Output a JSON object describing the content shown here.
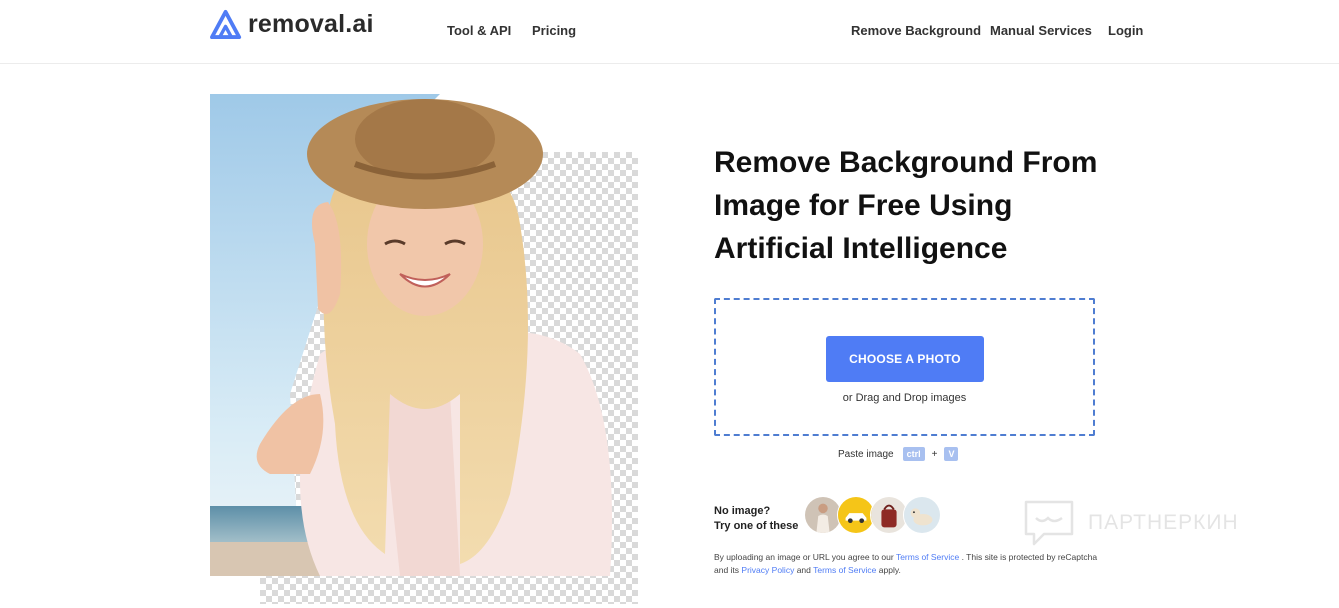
{
  "header": {
    "logo_text": "removal.ai",
    "nav_left": [
      "Tool & API",
      "Pricing"
    ],
    "nav_right": [
      "Remove Background",
      "Manual Services",
      "Login"
    ]
  },
  "hero": {
    "headline": "Remove Background From Image for Free Using Artificial Intelligence"
  },
  "upload": {
    "button_label": "CHOOSE A PHOTO",
    "drag_text": "or Drag and Drop images",
    "paste_label": "Paste image",
    "key_ctrl": "ctrl",
    "key_plus": "+",
    "key_v": "V"
  },
  "samples": {
    "prompt_line1": "No image?",
    "prompt_line2": "Try one of these",
    "items": [
      "person-sample",
      "car-sample",
      "bag-sample",
      "dog-sample"
    ]
  },
  "legal": {
    "part1": "By uploading an image or URL you agree to our",
    "tos_link": "Terms of Service",
    "part2": ". This site is protected by reCaptcha and its",
    "privacy_link": "Privacy Policy",
    "part3": "and",
    "tos_link2": "Terms of Service",
    "part4": "apply."
  },
  "watermark": {
    "text": "ПАРТНЕРКИН"
  },
  "colors": {
    "accent": "#4f7cf5",
    "dropzone_border": "#4f7dd1",
    "key_bg": "#a8c0f0"
  }
}
